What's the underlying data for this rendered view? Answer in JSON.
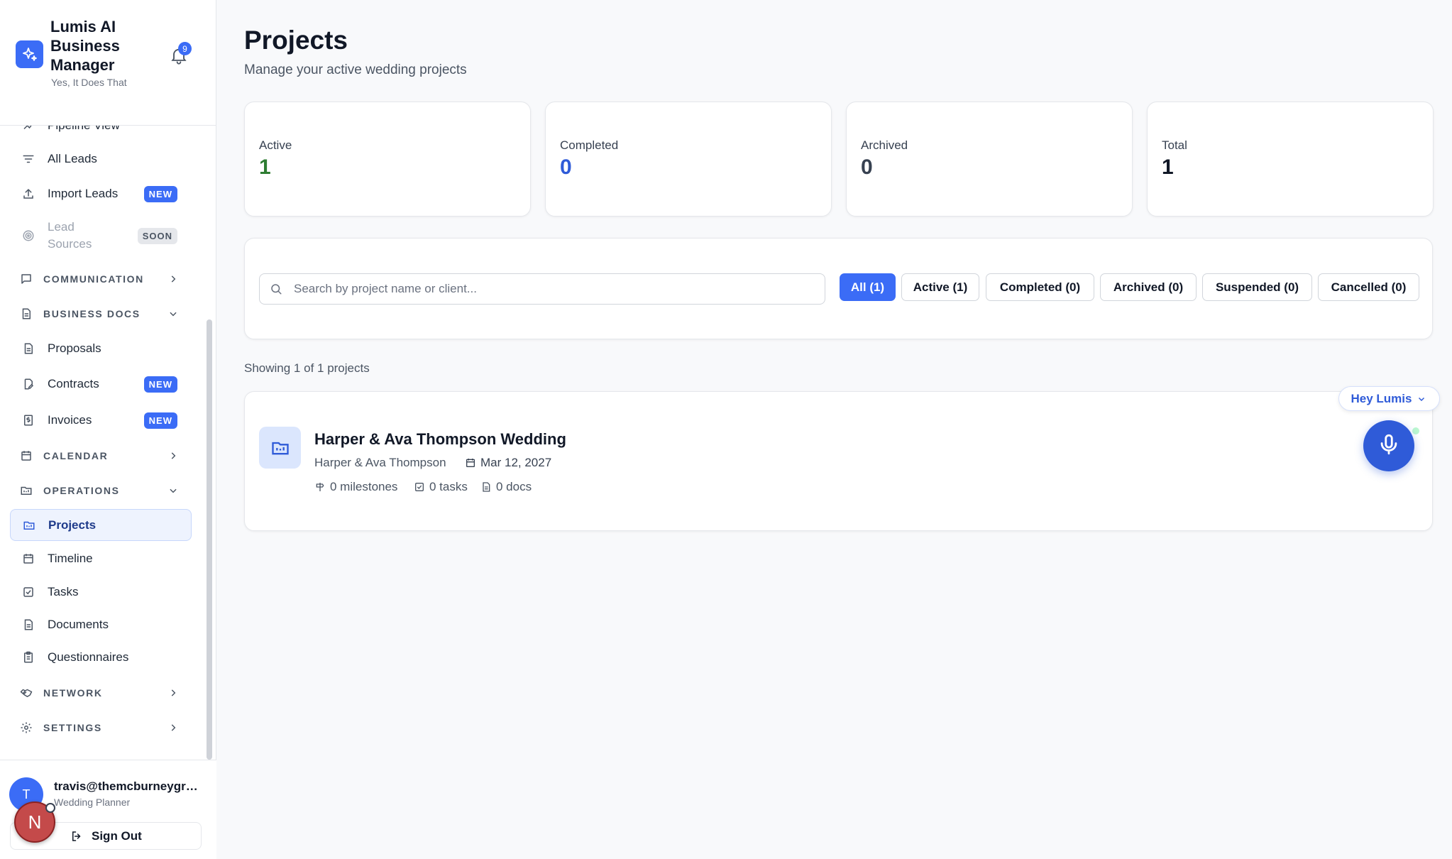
{
  "app": {
    "title": "Lumis AI Business Manager",
    "tagline": "Yes, It Does That",
    "notification_count": "9"
  },
  "sidebar": {
    "items": [
      {
        "label": "Pipeline View",
        "icon": "pipeline-icon"
      },
      {
        "label": "All Leads",
        "icon": "filter-lines-icon"
      },
      {
        "label": "Import Leads",
        "icon": "upload-icon",
        "badge": "NEW"
      },
      {
        "label": "Lead Sources",
        "icon": "target-icon",
        "badge": "SOON"
      }
    ],
    "sections": {
      "communication": "COMMUNICATION",
      "business_docs": "BUSINESS DOCS",
      "calendar": "CALENDAR",
      "operations": "OPERATIONS",
      "network": "NETWORK",
      "settings": "SETTINGS"
    },
    "business_docs_items": [
      {
        "label": "Proposals",
        "icon": "document-icon"
      },
      {
        "label": "Contracts",
        "icon": "contract-icon",
        "badge": "NEW"
      },
      {
        "label": "Invoices",
        "icon": "invoice-icon",
        "badge": "NEW"
      }
    ],
    "operations_items": [
      {
        "label": "Projects",
        "icon": "project-folder-icon",
        "active": true
      },
      {
        "label": "Timeline",
        "icon": "calendar-icon"
      },
      {
        "label": "Tasks",
        "icon": "check-square-icon"
      },
      {
        "label": "Documents",
        "icon": "document-icon"
      },
      {
        "label": "Questionnaires",
        "icon": "clipboard-icon"
      }
    ]
  },
  "user": {
    "initial": "T",
    "email": "travis@themcburneygroup.com",
    "role": "Wedding Planner",
    "sign_out": "Sign Out",
    "overlay_initial": "N"
  },
  "page": {
    "title": "Projects",
    "subtitle": "Manage your active wedding projects"
  },
  "stats": [
    {
      "label": "Active",
      "value": "1",
      "color": "#2e7d32"
    },
    {
      "label": "Completed",
      "value": "0",
      "color": "#2f5bd8"
    },
    {
      "label": "Archived",
      "value": "0",
      "color": "#374151"
    },
    {
      "label": "Total",
      "value": "1",
      "color": "#111827"
    }
  ],
  "search": {
    "placeholder": "Search by project name or client..."
  },
  "filters": [
    {
      "label": "All (1)",
      "active": true
    },
    {
      "label": "Active (1)"
    },
    {
      "label": "Completed (0)"
    },
    {
      "label": "Archived (0)"
    },
    {
      "label": "Suspended (0)"
    },
    {
      "label": "Cancelled (0)"
    }
  ],
  "results_text": "Showing 1 of 1 projects",
  "projects": [
    {
      "title": "Harper & Ava Thompson Wedding",
      "client": "Harper & Ava Thompson",
      "date": "Mar 12, 2027",
      "milestones": "0 milestones",
      "tasks": "0 tasks",
      "docs": "0 docs"
    }
  ],
  "assistant": {
    "label": "Hey Lumis"
  },
  "colors": {
    "accent": "#3b6cf6",
    "active_green": "#2e7d32"
  }
}
